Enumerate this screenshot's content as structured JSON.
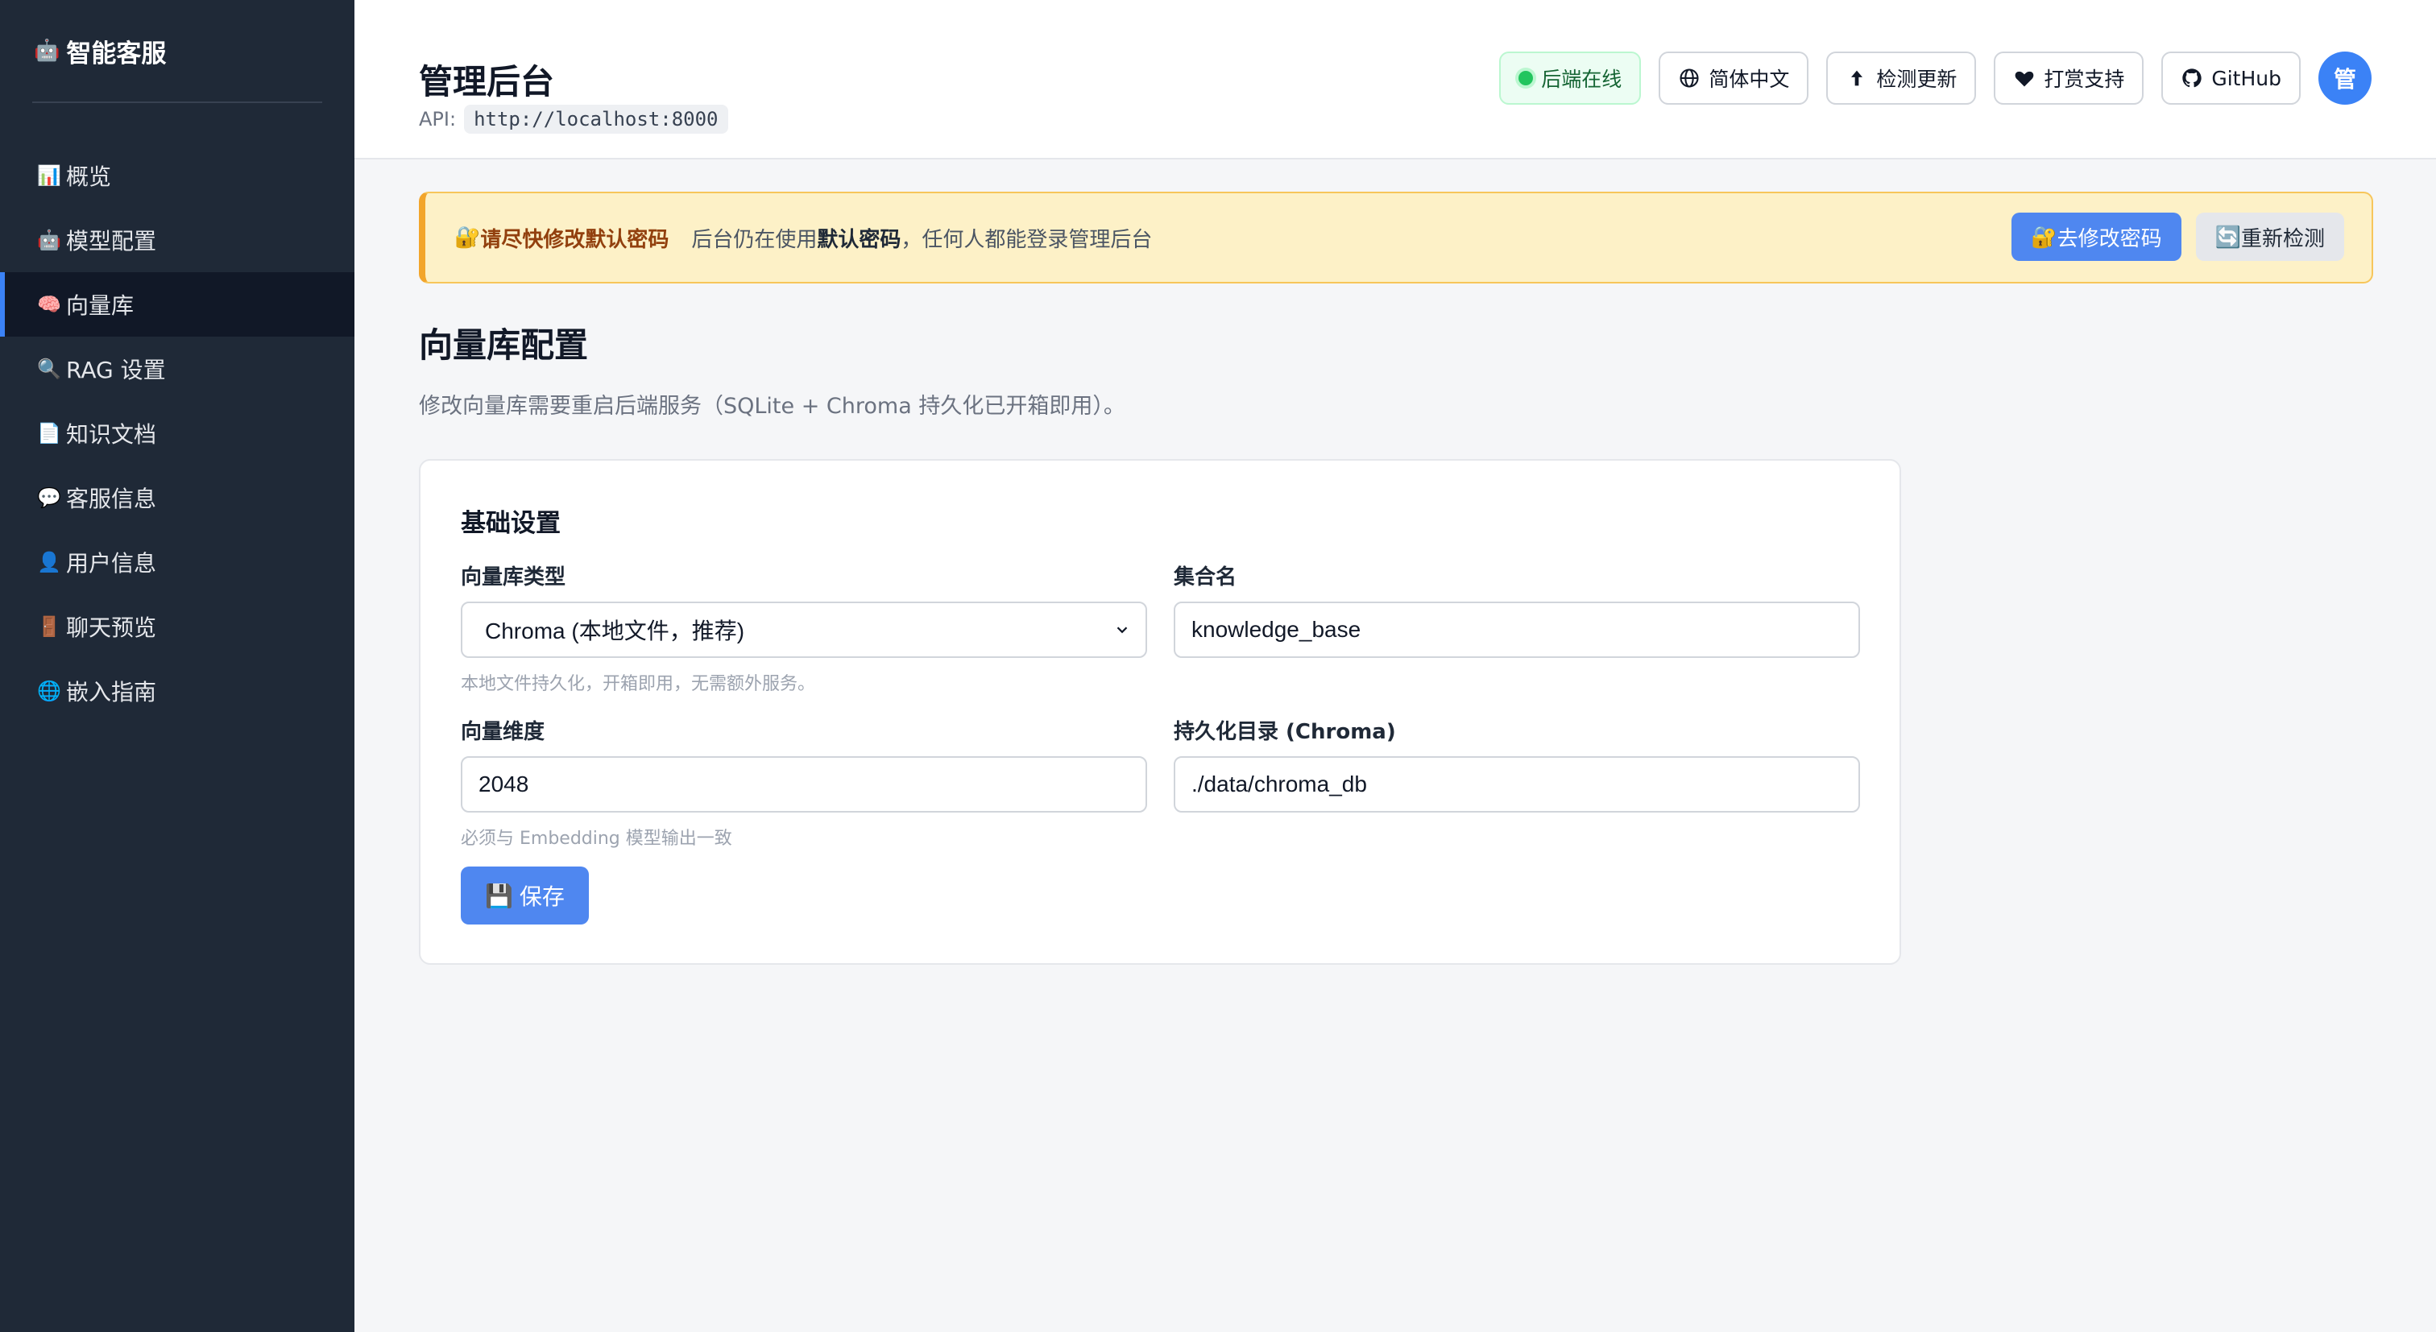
{
  "sidebar": {
    "brand": {
      "emoji": "🤖",
      "name": "智能客服"
    },
    "items": [
      {
        "emoji": "📊",
        "label": "概览"
      },
      {
        "emoji": "🤖",
        "label": "模型配置"
      },
      {
        "emoji": "🧠",
        "label": "向量库",
        "active": true
      },
      {
        "emoji": "🔍",
        "label": "RAG 设置"
      },
      {
        "emoji": "📄",
        "label": "知识文档"
      },
      {
        "emoji": "💬",
        "label": "客服信息"
      },
      {
        "emoji": "👤",
        "label": "用户信息"
      },
      {
        "emoji": "🚪",
        "label": "聊天预览"
      },
      {
        "emoji": "🌐",
        "label": "嵌入指南"
      }
    ]
  },
  "header": {
    "title": "管理后台",
    "api_label": "API:",
    "api_url": "http://localhost:8000",
    "status_label": "后端在线",
    "language_label": "简体中文",
    "update_label": "检测更新",
    "donate_label": "打赏支持",
    "github_label": "GitHub",
    "avatar_text": "管"
  },
  "banner": {
    "emoji": "🔐",
    "title": "请尽快修改默认密码",
    "msg_prefix": "后台仍在使用",
    "msg_bold": "默认密码",
    "msg_suffix": "，任何人都能登录管理后台",
    "change_button": {
      "emoji": "🔐",
      "label": "去修改密码"
    },
    "recheck_button": {
      "emoji": "🔄",
      "label": "重新检测"
    }
  },
  "section": {
    "title": "向量库配置",
    "description": "修改向量库需要重启后端服务（SQLite + Chroma 持久化已开箱即用）。"
  },
  "card": {
    "title": "基础设置",
    "fields": {
      "type": {
        "label": "向量库类型",
        "value": "Chroma (本地文件，推荐)",
        "hint": "本地文件持久化，开箱即用，无需额外服务。"
      },
      "collection": {
        "label": "集合名",
        "value": "knowledge_base"
      },
      "dimension": {
        "label": "向量维度",
        "value": "2048",
        "hint": "必须与 Embedding 模型输出一致"
      },
      "persist_dir": {
        "label": "持久化目录 (Chroma)",
        "value": "./data/chroma_db"
      }
    },
    "save_button": {
      "emoji": "💾",
      "label": "保存"
    }
  },
  "colors": {
    "sidebar_bg": "#1f2937",
    "accent": "#4f87f0",
    "status_green": "#22c55e",
    "warning_bg": "#fdf1c7"
  }
}
